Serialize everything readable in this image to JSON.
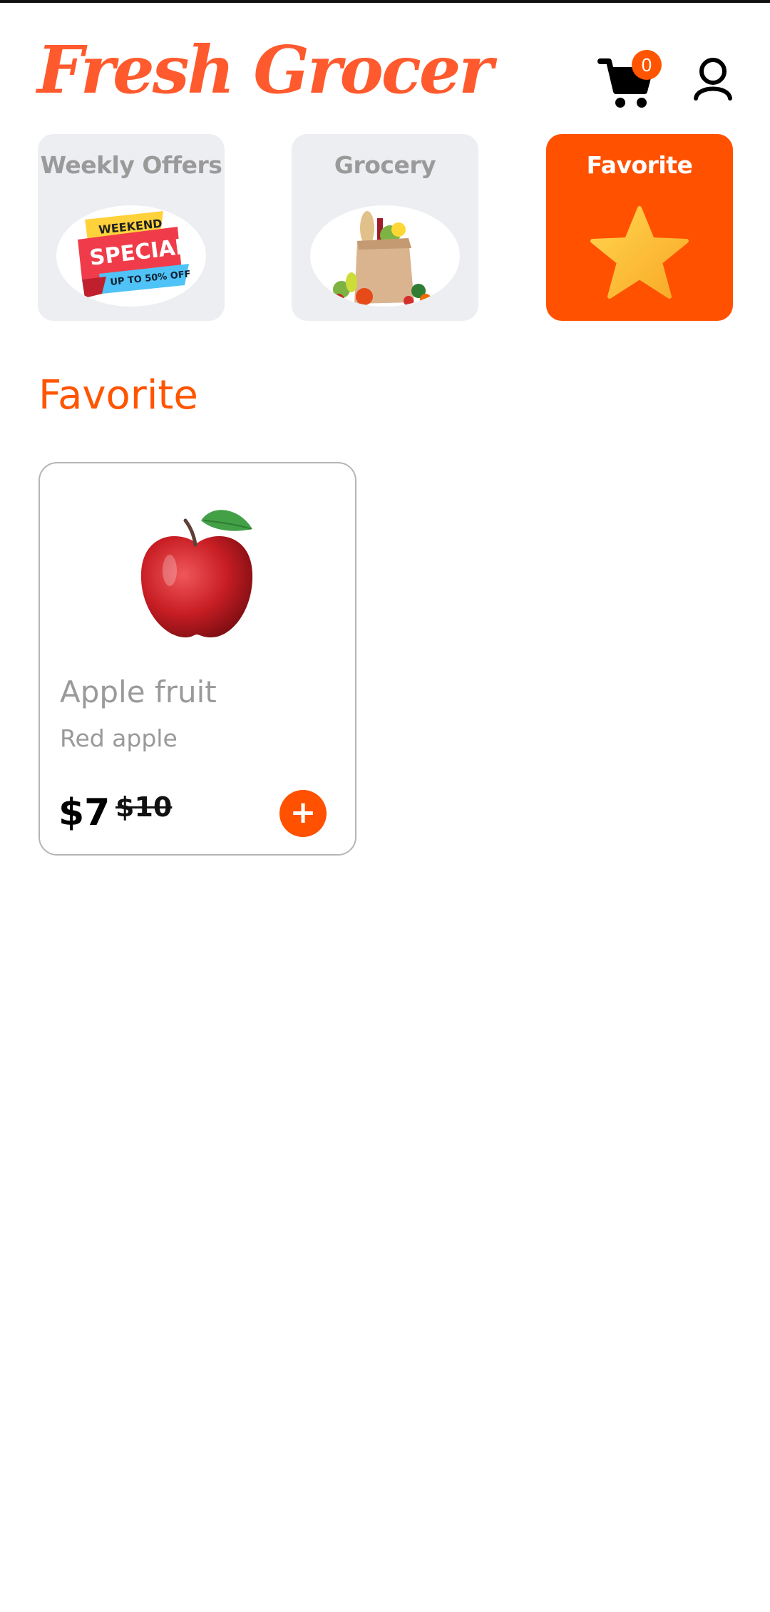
{
  "app": {
    "title": "Fresh Grocer"
  },
  "header": {
    "cart_count": "0",
    "cart_icon": "shopping-cart-icon",
    "profile_icon": "user-icon"
  },
  "categories": [
    {
      "label": "Weekly Offers",
      "image": "weekend-specials-banner",
      "banner_texts": [
        "WEEKEND",
        "SPECIALS",
        "UP TO 50% OFF"
      ],
      "active": false
    },
    {
      "label": "Grocery",
      "image": "grocery-bag-image",
      "active": false
    },
    {
      "label": "Favorite",
      "image": "star-icon",
      "active": true
    }
  ],
  "section": {
    "title": "Favorite"
  },
  "products": [
    {
      "name": "Apple fruit",
      "description": "Red apple",
      "price": "$7",
      "old_price": "$10",
      "image": "red-apple-image",
      "add_label": "+"
    }
  ],
  "colors": {
    "accent": "#ff5100",
    "logo": "#ff5a2e",
    "tile_bg": "#eceef2",
    "muted_text": "#9a9a9a",
    "star": "#fbc531"
  }
}
